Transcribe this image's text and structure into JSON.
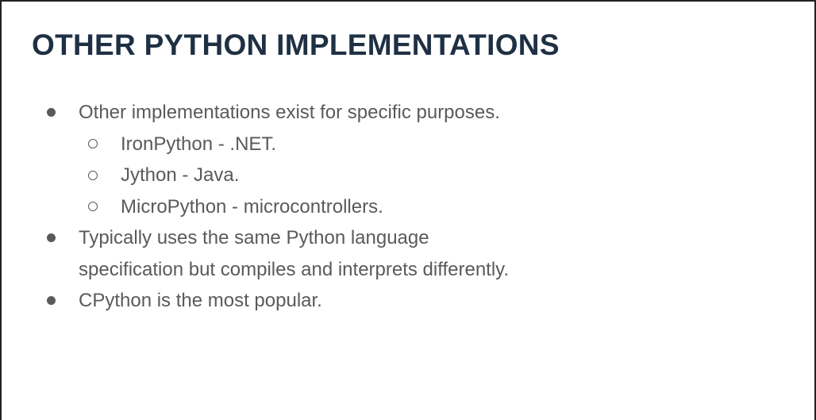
{
  "slide": {
    "title": "OTHER PYTHON IMPLEMENTATIONS",
    "bullets": [
      "Other implementations exist for specific purposes.",
      "IronPython - .NET.",
      "Jython - Java.",
      "MicroPython - microcontrollers.",
      "Typically uses the same Python language",
      "specification but compiles and interprets differently.",
      "CPython is the most popular."
    ]
  },
  "colors": {
    "title": "#1f3044",
    "body_text": "#5a5a5a",
    "border": "#222222",
    "background": "#ffffff"
  }
}
